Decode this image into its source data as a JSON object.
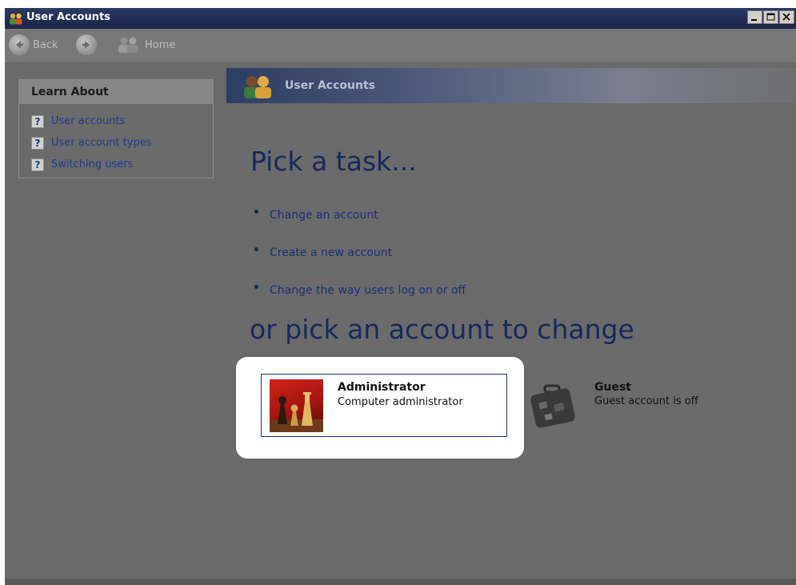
{
  "window": {
    "title": "User Accounts",
    "app_icon": "users-icon",
    "controls": [
      "minimize-icon",
      "maximize-icon",
      "close-icon"
    ]
  },
  "toolbar": {
    "back_label": "Back",
    "forward_icon": "forward-arrow-icon",
    "home_label": "Home"
  },
  "sidebar": {
    "heading": "Learn About",
    "items": [
      {
        "label": "User accounts",
        "icon": "help-icon"
      },
      {
        "label": "User account types",
        "icon": "help-icon"
      },
      {
        "label": "Switching users",
        "icon": "help-icon"
      }
    ]
  },
  "header": {
    "title": "User Accounts",
    "icon": "user-accounts-icon"
  },
  "main": {
    "task_heading": "Pick a task...",
    "tasks": [
      {
        "label": "Change an account"
      },
      {
        "label": "Create a new account"
      },
      {
        "label": "Change the way users log on or off"
      }
    ],
    "account_heading": "or pick an account to change",
    "accounts": [
      {
        "name": "Administrator",
        "type": "Computer administrator",
        "picture": "chess-pieces-icon"
      },
      {
        "name": "Guest",
        "type": "Guest account is off",
        "picture": "suitcase-icon"
      }
    ]
  },
  "colors": {
    "heading": "#15295e",
    "link": "#1c2f78",
    "background": "#6a6a6a",
    "highlight": "#ffffff"
  }
}
